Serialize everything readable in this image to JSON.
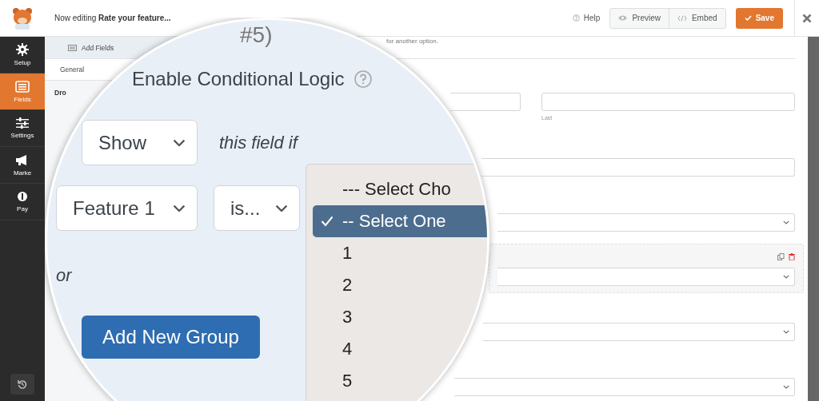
{
  "sidebar": {
    "items": [
      {
        "label": "Setup",
        "kind": "gear",
        "selected": false
      },
      {
        "label": "Fields",
        "kind": "fields",
        "selected": true
      },
      {
        "label": "Settings",
        "kind": "sliders",
        "selected": false
      },
      {
        "label": "Marke",
        "kind": "megaphone",
        "selected": false
      },
      {
        "label": "Pay",
        "kind": "payments",
        "selected": false
      }
    ]
  },
  "header": {
    "title": "Now editing **Rate your feature...**",
    "help": "Help",
    "buttons": [
      {
        "label": "Preview",
        "kind": "preview"
      },
      {
        "label": "Embed",
        "kind": "embed"
      }
    ],
    "save": "Save"
  },
  "field_options": {
    "tab": "Add Fields",
    "subtab": "General",
    "field_label": "Dro"
  },
  "preview": {
    "description": "for another option.",
    "fields": [
      {
        "kind": "name",
        "sublabel": "Last",
        "selected": false
      },
      {
        "kind": "text",
        "selected": false
      },
      {
        "kind": "select",
        "selected": false
      },
      {
        "kind": "select",
        "selected": true
      },
      {
        "kind": "select",
        "selected": false
      },
      {
        "kind": "select",
        "selected": false
      }
    ]
  },
  "magnifier": {
    "heading_fragment": "#5)",
    "title": "Enable Conditional Logic",
    "action_select": "Show",
    "action_suffix": "this field if",
    "field_select": "Feature 1",
    "operator_select": "is...",
    "value_menu": [
      {
        "label": "--- Select Cho",
        "selected": false
      },
      {
        "label": "-- Select One",
        "selected": true
      },
      {
        "label": "1",
        "selected": false
      },
      {
        "label": "2",
        "selected": false
      },
      {
        "label": "3",
        "selected": false
      },
      {
        "label": "4",
        "selected": false
      },
      {
        "label": "5",
        "selected": false
      }
    ],
    "or_label": "or",
    "add_group_button": "Add New Group"
  }
}
